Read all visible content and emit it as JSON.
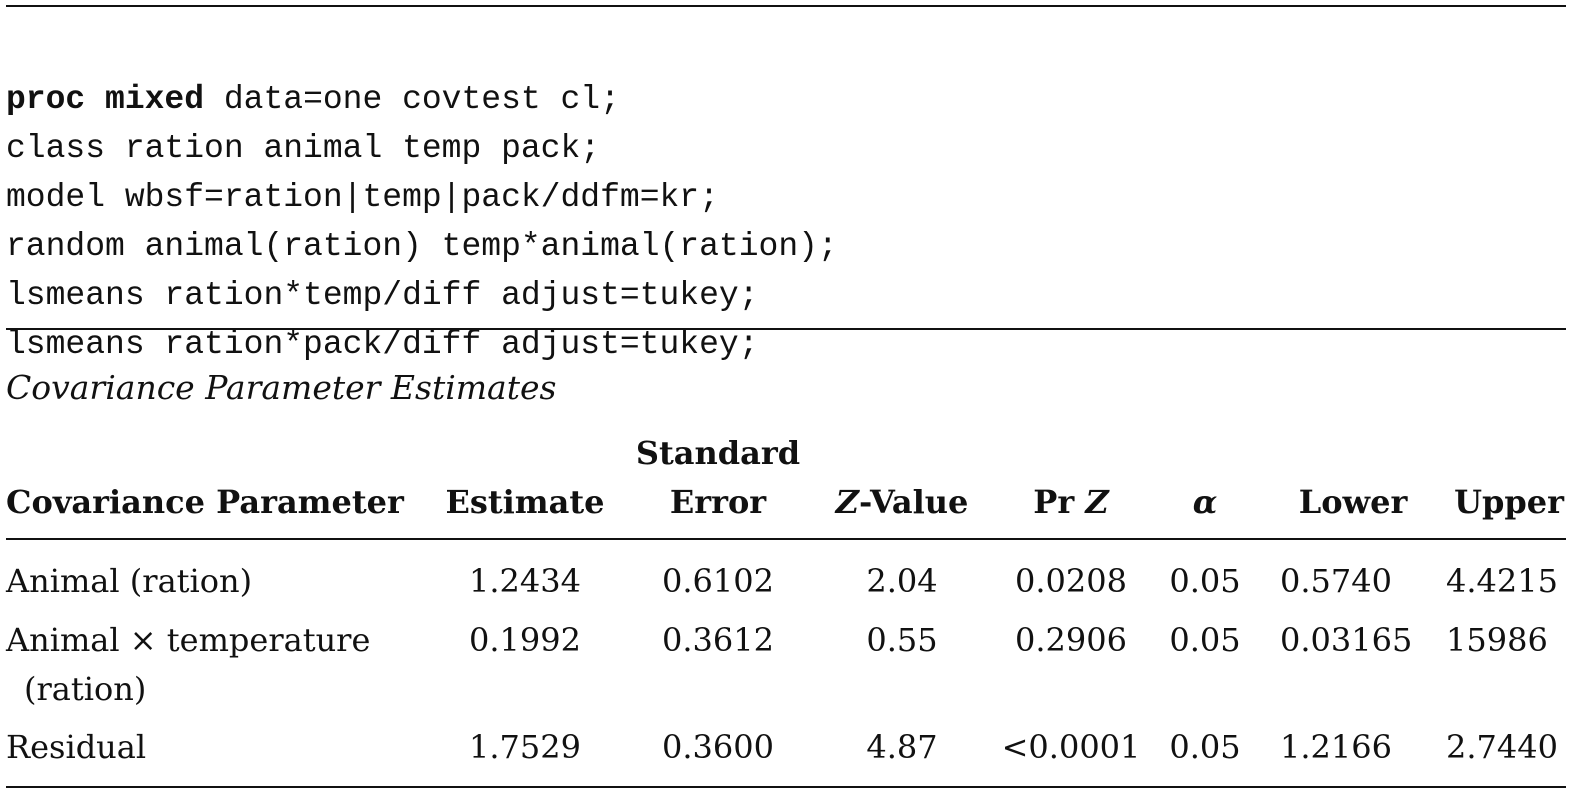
{
  "code": {
    "lines": [
      {
        "kw": "proc mixed",
        "rest": " data=one covtest cl;"
      },
      {
        "kw": "",
        "rest": "class ration animal temp pack;"
      },
      {
        "kw": "",
        "rest": "model wbsf=ration|temp|pack/ddfm=kr;"
      },
      {
        "kw": "",
        "rest": "random animal(ration) temp*animal(ration);"
      },
      {
        "kw": "",
        "rest": "lsmeans ration*temp/diff adjust=tukey;"
      },
      {
        "kw": "",
        "rest": "lsmeans ration*pack/diff adjust=tukey;"
      }
    ]
  },
  "table": {
    "caption": "Covariance Parameter Estimates",
    "headers": {
      "parameter": "Covariance Parameter",
      "estimate": "Estimate",
      "stderr_top": "Standard",
      "stderr_bottom": "Error",
      "zvalue_z": "Z",
      "zvalue_rest": "-Value",
      "prz_pr": "Pr ",
      "prz_z": "Z",
      "alpha": "α",
      "lower": "Lower",
      "upper": "Upper"
    },
    "rows": [
      {
        "parameter": "Animal (ration)",
        "parameter_cont": "",
        "estimate": "1.2434",
        "stderr": "0.6102",
        "zvalue": "2.04",
        "prz": "0.0208",
        "alpha": "0.05",
        "lower": "0.5740",
        "upper": "4.4215"
      },
      {
        "parameter": "Animal × temperature",
        "parameter_cont": "(ration)",
        "estimate": "0.1992",
        "stderr": "0.3612",
        "zvalue": "0.55",
        "prz": "0.2906",
        "alpha": "0.05",
        "lower": "0.03165",
        "upper": "15986"
      },
      {
        "parameter": "Residual",
        "parameter_cont": "",
        "estimate": "1.7529",
        "stderr": "0.3600",
        "zvalue": "4.87",
        "prz": "<0.0001",
        "alpha": "0.05",
        "lower": "1.2166",
        "upper": "2.7440"
      }
    ]
  }
}
